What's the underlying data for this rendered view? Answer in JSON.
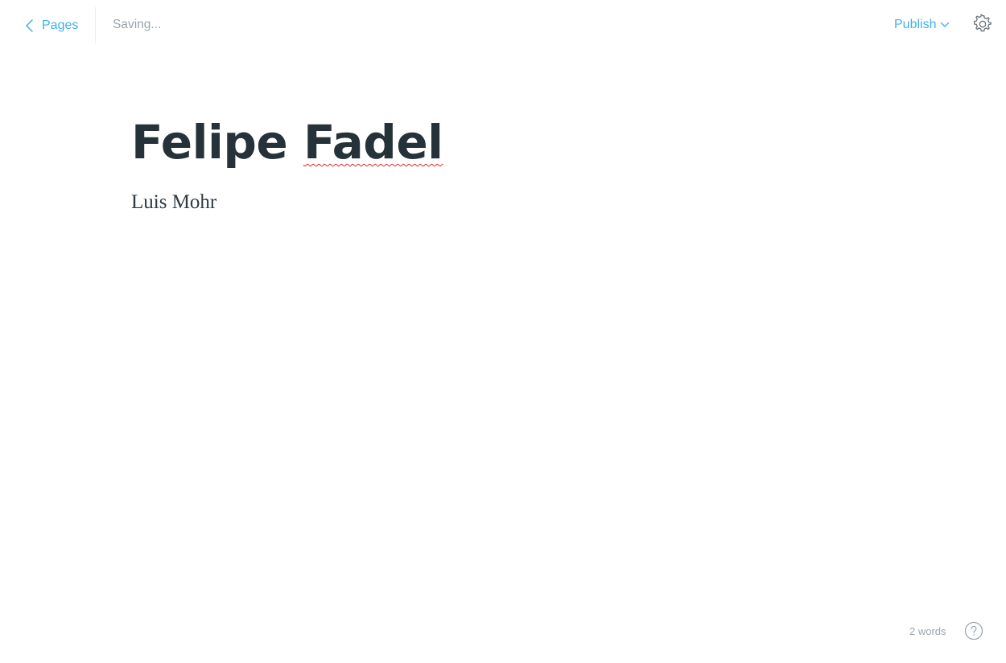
{
  "header": {
    "back_label": "Pages",
    "status_text": "Saving...",
    "publish_label": "Publish"
  },
  "post": {
    "title_first": "Felipe",
    "title_second": "Fadel",
    "body": "Luis Mohr"
  },
  "footer": {
    "word_count": "2 words"
  },
  "icons": {
    "back": "chevron-left-icon",
    "publish_caret": "chevron-down-icon",
    "settings": "gear-icon",
    "help": "question-circle-icon"
  },
  "colors": {
    "accent": "#3eb0ef",
    "text_dark": "#26323a",
    "muted": "#9aa5ab",
    "spellcheck": "#e0262f"
  }
}
